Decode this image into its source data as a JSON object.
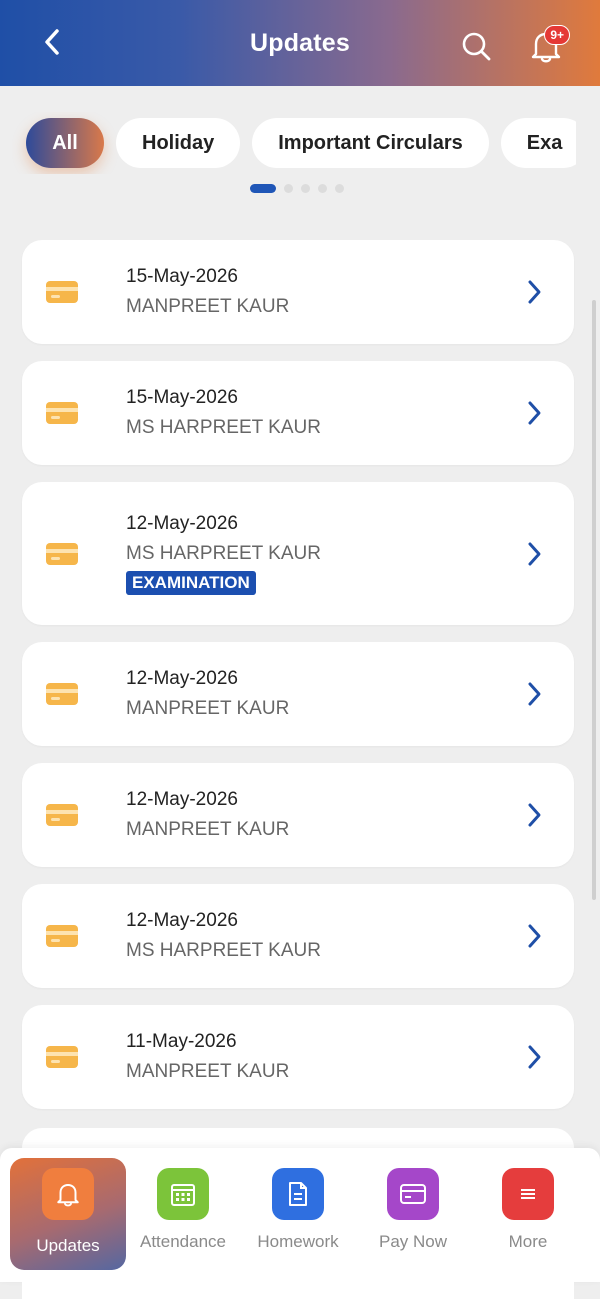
{
  "header": {
    "title": "Updates",
    "notification_count": "9+"
  },
  "filters": {
    "chips": [
      {
        "label": "All",
        "active": true
      },
      {
        "label": "Holiday",
        "active": false
      },
      {
        "label": "Important Circulars",
        "active": false
      },
      {
        "label": "Exa",
        "active": false
      }
    ]
  },
  "updates": [
    {
      "date": "15-May-2026",
      "author": "MANPREET KAUR",
      "tag": ""
    },
    {
      "date": "15-May-2026",
      "author": "MS HARPREET KAUR",
      "tag": ""
    },
    {
      "date": "12-May-2026",
      "author": "MS HARPREET KAUR",
      "tag": "EXAMINATION"
    },
    {
      "date": "12-May-2026",
      "author": "MANPREET KAUR",
      "tag": ""
    },
    {
      "date": "12-May-2026",
      "author": "MANPREET KAUR",
      "tag": ""
    },
    {
      "date": "12-May-2026",
      "author": "MS HARPREET KAUR",
      "tag": ""
    },
    {
      "date": "11-May-2026",
      "author": "MANPREET KAUR",
      "tag": ""
    }
  ],
  "bottom_nav": [
    {
      "label": "Updates",
      "color": "#f07e3e",
      "icon": "bell-icon",
      "active": true
    },
    {
      "label": "Attendance",
      "color": "#7cc43a",
      "icon": "calendar-icon",
      "active": false
    },
    {
      "label": "Homework",
      "color": "#2f6fe0",
      "icon": "document-icon",
      "active": false
    },
    {
      "label": "Pay Now",
      "color": "#a547c9",
      "icon": "card-icon",
      "active": false
    },
    {
      "label": "More",
      "color": "#e53d3d",
      "icon": "menu-icon",
      "active": false
    }
  ],
  "colors": {
    "accent_blue": "#1f56b7",
    "accent_orange": "#e07a3c",
    "card_icon": "#f6b64a"
  }
}
